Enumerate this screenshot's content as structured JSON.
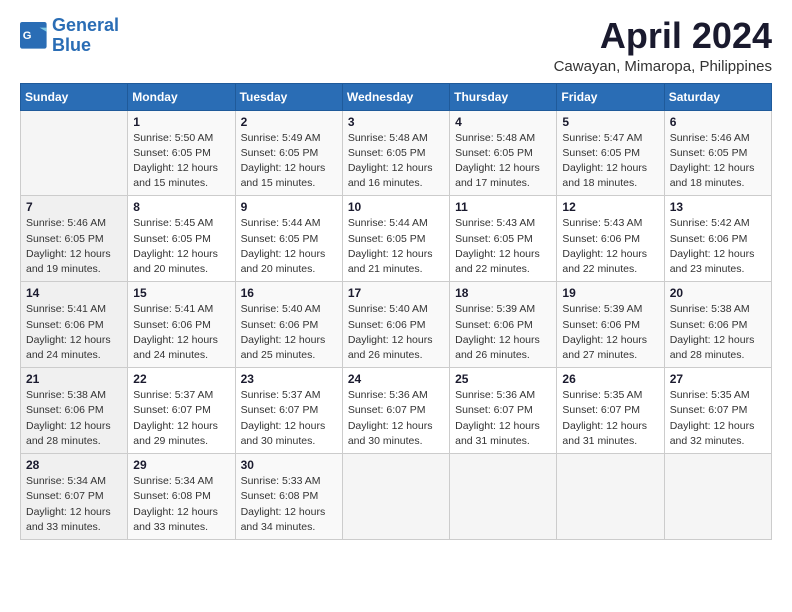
{
  "logo": {
    "line1": "General",
    "line2": "Blue"
  },
  "title": "April 2024",
  "subtitle": "Cawayan, Mimaropa, Philippines",
  "calendar": {
    "headers": [
      "Sunday",
      "Monday",
      "Tuesday",
      "Wednesday",
      "Thursday",
      "Friday",
      "Saturday"
    ],
    "weeks": [
      [
        {
          "day": "",
          "content": ""
        },
        {
          "day": "1",
          "content": "Sunrise: 5:50 AM\nSunset: 6:05 PM\nDaylight: 12 hours\nand 15 minutes."
        },
        {
          "day": "2",
          "content": "Sunrise: 5:49 AM\nSunset: 6:05 PM\nDaylight: 12 hours\nand 15 minutes."
        },
        {
          "day": "3",
          "content": "Sunrise: 5:48 AM\nSunset: 6:05 PM\nDaylight: 12 hours\nand 16 minutes."
        },
        {
          "day": "4",
          "content": "Sunrise: 5:48 AM\nSunset: 6:05 PM\nDaylight: 12 hours\nand 17 minutes."
        },
        {
          "day": "5",
          "content": "Sunrise: 5:47 AM\nSunset: 6:05 PM\nDaylight: 12 hours\nand 18 minutes."
        },
        {
          "day": "6",
          "content": "Sunrise: 5:46 AM\nSunset: 6:05 PM\nDaylight: 12 hours\nand 18 minutes."
        }
      ],
      [
        {
          "day": "7",
          "content": "Sunrise: 5:46 AM\nSunset: 6:05 PM\nDaylight: 12 hours\nand 19 minutes."
        },
        {
          "day": "8",
          "content": "Sunrise: 5:45 AM\nSunset: 6:05 PM\nDaylight: 12 hours\nand 20 minutes."
        },
        {
          "day": "9",
          "content": "Sunrise: 5:44 AM\nSunset: 6:05 PM\nDaylight: 12 hours\nand 20 minutes."
        },
        {
          "day": "10",
          "content": "Sunrise: 5:44 AM\nSunset: 6:05 PM\nDaylight: 12 hours\nand 21 minutes."
        },
        {
          "day": "11",
          "content": "Sunrise: 5:43 AM\nSunset: 6:05 PM\nDaylight: 12 hours\nand 22 minutes."
        },
        {
          "day": "12",
          "content": "Sunrise: 5:43 AM\nSunset: 6:06 PM\nDaylight: 12 hours\nand 22 minutes."
        },
        {
          "day": "13",
          "content": "Sunrise: 5:42 AM\nSunset: 6:06 PM\nDaylight: 12 hours\nand 23 minutes."
        }
      ],
      [
        {
          "day": "14",
          "content": "Sunrise: 5:41 AM\nSunset: 6:06 PM\nDaylight: 12 hours\nand 24 minutes."
        },
        {
          "day": "15",
          "content": "Sunrise: 5:41 AM\nSunset: 6:06 PM\nDaylight: 12 hours\nand 24 minutes."
        },
        {
          "day": "16",
          "content": "Sunrise: 5:40 AM\nSunset: 6:06 PM\nDaylight: 12 hours\nand 25 minutes."
        },
        {
          "day": "17",
          "content": "Sunrise: 5:40 AM\nSunset: 6:06 PM\nDaylight: 12 hours\nand 26 minutes."
        },
        {
          "day": "18",
          "content": "Sunrise: 5:39 AM\nSunset: 6:06 PM\nDaylight: 12 hours\nand 26 minutes."
        },
        {
          "day": "19",
          "content": "Sunrise: 5:39 AM\nSunset: 6:06 PM\nDaylight: 12 hours\nand 27 minutes."
        },
        {
          "day": "20",
          "content": "Sunrise: 5:38 AM\nSunset: 6:06 PM\nDaylight: 12 hours\nand 28 minutes."
        }
      ],
      [
        {
          "day": "21",
          "content": "Sunrise: 5:38 AM\nSunset: 6:06 PM\nDaylight: 12 hours\nand 28 minutes."
        },
        {
          "day": "22",
          "content": "Sunrise: 5:37 AM\nSunset: 6:07 PM\nDaylight: 12 hours\nand 29 minutes."
        },
        {
          "day": "23",
          "content": "Sunrise: 5:37 AM\nSunset: 6:07 PM\nDaylight: 12 hours\nand 30 minutes."
        },
        {
          "day": "24",
          "content": "Sunrise: 5:36 AM\nSunset: 6:07 PM\nDaylight: 12 hours\nand 30 minutes."
        },
        {
          "day": "25",
          "content": "Sunrise: 5:36 AM\nSunset: 6:07 PM\nDaylight: 12 hours\nand 31 minutes."
        },
        {
          "day": "26",
          "content": "Sunrise: 5:35 AM\nSunset: 6:07 PM\nDaylight: 12 hours\nand 31 minutes."
        },
        {
          "day": "27",
          "content": "Sunrise: 5:35 AM\nSunset: 6:07 PM\nDaylight: 12 hours\nand 32 minutes."
        }
      ],
      [
        {
          "day": "28",
          "content": "Sunrise: 5:34 AM\nSunset: 6:07 PM\nDaylight: 12 hours\nand 33 minutes."
        },
        {
          "day": "29",
          "content": "Sunrise: 5:34 AM\nSunset: 6:08 PM\nDaylight: 12 hours\nand 33 minutes."
        },
        {
          "day": "30",
          "content": "Sunrise: 5:33 AM\nSunset: 6:08 PM\nDaylight: 12 hours\nand 34 minutes."
        },
        {
          "day": "",
          "content": ""
        },
        {
          "day": "",
          "content": ""
        },
        {
          "day": "",
          "content": ""
        },
        {
          "day": "",
          "content": ""
        }
      ]
    ]
  }
}
